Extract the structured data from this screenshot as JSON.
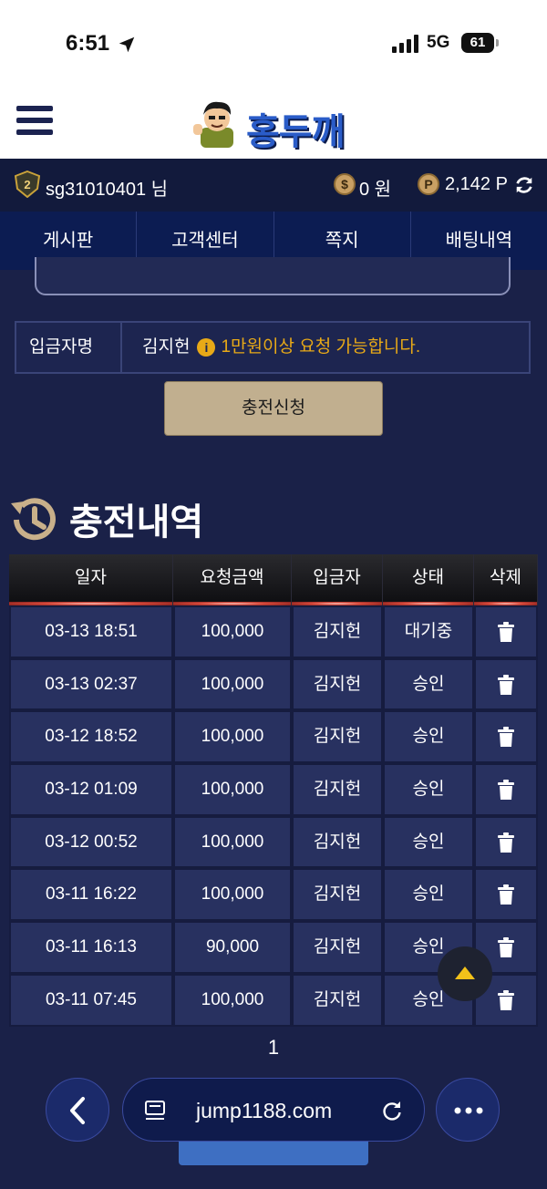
{
  "status_bar": {
    "time": "6:51",
    "network": "5G",
    "battery": "61"
  },
  "header": {
    "logo_text": "홍두깨"
  },
  "user_bar": {
    "username": "sg31010401 님",
    "money": "0 원",
    "coin_symbol": "$",
    "point_symbol": "P",
    "points": "2,142 P"
  },
  "nav": {
    "items": [
      "게시판",
      "고객센터",
      "쪽지",
      "배팅내역"
    ]
  },
  "deposit_form": {
    "depositor_label": "입금자명",
    "depositor_value": "김지헌",
    "info_icon": "i",
    "info_text": "1만원이상 요청 가능합니다.",
    "submit_label": "충전신청"
  },
  "history": {
    "title": "충전내역",
    "columns": [
      "일자",
      "요청금액",
      "입금자",
      "상태",
      "삭제"
    ],
    "rows": [
      {
        "date": "03-13 18:51",
        "amount": "100,000",
        "depositor": "김지헌",
        "status": "대기중"
      },
      {
        "date": "03-13 02:37",
        "amount": "100,000",
        "depositor": "김지헌",
        "status": "승인"
      },
      {
        "date": "03-12 18:52",
        "amount": "100,000",
        "depositor": "김지헌",
        "status": "승인"
      },
      {
        "date": "03-12 01:09",
        "amount": "100,000",
        "depositor": "김지헌",
        "status": "승인"
      },
      {
        "date": "03-12 00:52",
        "amount": "100,000",
        "depositor": "김지헌",
        "status": "승인"
      },
      {
        "date": "03-11 16:22",
        "amount": "100,000",
        "depositor": "김지헌",
        "status": "승인"
      },
      {
        "date": "03-11 16:13",
        "amount": "90,000",
        "depositor": "김지헌",
        "status": "승인"
      },
      {
        "date": "03-11 07:45",
        "amount": "100,000",
        "depositor": "김지헌",
        "status": "승인"
      }
    ],
    "page": "1"
  },
  "browser": {
    "url": "jump1188.com"
  },
  "colors": {
    "accent_gold": "#e8a917",
    "button_tan": "#c1af8f",
    "nav_blue": "#0c1c52",
    "logo_blue": "#2a5cc8"
  },
  "icons": [
    "location-arrow-icon",
    "signal-icon",
    "menu-icon",
    "level-badge-icon",
    "coin-icon",
    "point-icon",
    "refresh-icon",
    "info-icon",
    "history-icon",
    "trash-icon",
    "chevron-up-icon",
    "chevron-left-icon",
    "reader-icon",
    "reload-icon",
    "ellipsis-icon"
  ]
}
